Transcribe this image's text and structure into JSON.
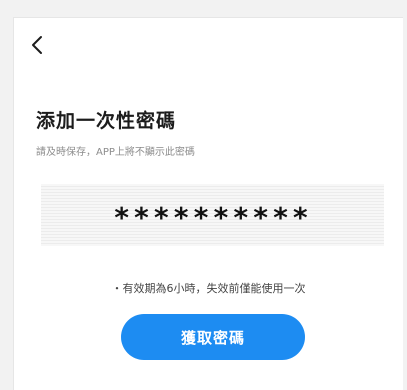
{
  "header": {
    "back_icon": "chevron-left-icon"
  },
  "page": {
    "title": "添加一次性密碼",
    "subtitle": "請及時保存，APP上將不顯示此密碼"
  },
  "password": {
    "value": "**********"
  },
  "note": "・有效期為6小時，失效前僅能使用一次",
  "action": {
    "button_label": "獲取密碼"
  },
  "colors": {
    "accent": "#1d8cf2",
    "background": "#ffffff",
    "text": "#1c1c1c",
    "muted": "#8c8c8c"
  }
}
